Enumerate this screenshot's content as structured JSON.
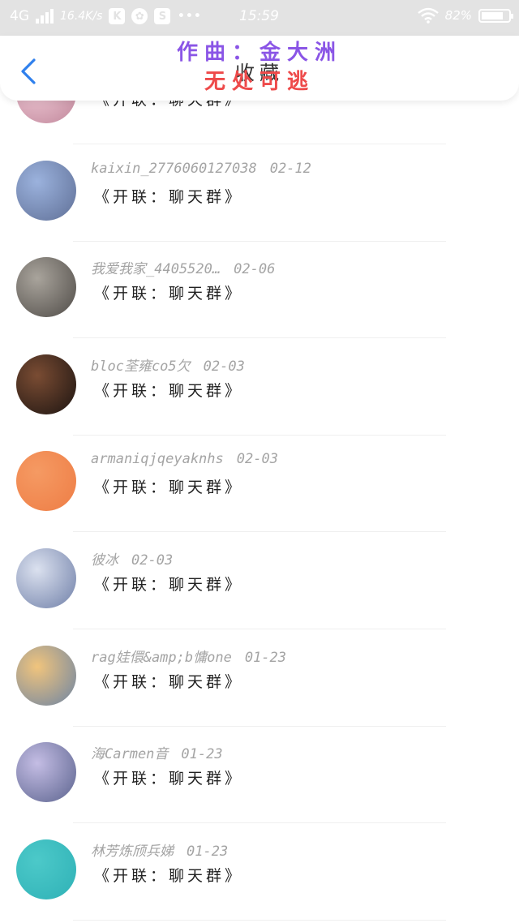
{
  "status_bar": {
    "network": "4G",
    "speed": "16.4K/s",
    "icon_k": "K",
    "icon_s": "S",
    "more": "•••",
    "time": "15:59",
    "battery": "82%",
    "battery_level": 0.82
  },
  "header": {
    "title": "收藏",
    "credit_composer": "作曲：金大洲",
    "credit_song": "无处可逃"
  },
  "items": [
    {
      "sender": "",
      "date": "",
      "text": "《开联：聊天群》",
      "avatar": [
        "#f2cdd9",
        "#c0869a"
      ]
    },
    {
      "sender": "kaixin_2776060127038",
      "date": "02-12",
      "text": "《开联：聊天群》",
      "avatar": [
        "#9bb2dd",
        "#5f6f96"
      ]
    },
    {
      "sender": "我爱我家_4405520…",
      "date": "02-06",
      "text": "《开联：聊天群》",
      "avatar": [
        "#a9a49c",
        "#4f4b47"
      ]
    },
    {
      "sender": "bloc荃雍co5欠",
      "date": "02-03",
      "text": "《开联：聊天群》",
      "avatar": [
        "#7a4c33",
        "#1c1411"
      ]
    },
    {
      "sender": "armaniqjqeyaknhs",
      "date": "02-03",
      "text": "《开联：聊天群》",
      "avatar": [
        "#f59a63",
        "#ee7d45"
      ]
    },
    {
      "sender": "彼冰",
      "date": "02-03",
      "text": "《开联：聊天群》",
      "avatar": [
        "#dbe1ef",
        "#6f7fa8"
      ]
    },
    {
      "sender": "rag娃儇&amp;b慵one",
      "date": "01-23",
      "text": "《开联：聊天群》",
      "avatar": [
        "#f0c47d",
        "#6c84a4"
      ]
    },
    {
      "sender": "海Carmen音",
      "date": "01-23",
      "text": "《开联：聊天群》",
      "avatar": [
        "#c4bde4",
        "#5b638e"
      ]
    },
    {
      "sender": "林芳炼颀兵娣",
      "date": "01-23",
      "text": "《开联：聊天群》",
      "avatar": [
        "#4cc9c9",
        "#2fb1b6"
      ]
    }
  ],
  "colors": {
    "accent": "#2f80ed",
    "credit_purple": "#8a55e6",
    "credit_red": "#ee4a4a",
    "status_bar_bg": "#e3e3e3"
  },
  "icons": {
    "back": "chevron-left-icon",
    "wifi": "wifi-icon",
    "signal": "signal-icon",
    "battery": "battery-icon"
  }
}
